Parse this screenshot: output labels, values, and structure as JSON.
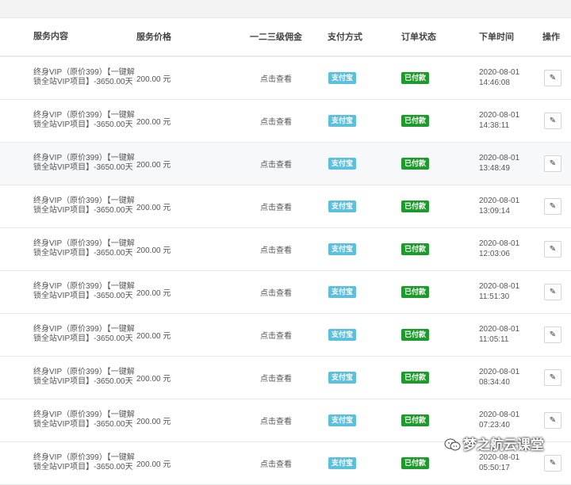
{
  "table": {
    "headers": {
      "service": "服务内容",
      "price": "服务价格",
      "commission": "一二三级佣金",
      "pay_method": "支付方式",
      "status": "订单状态",
      "time": "下单时间",
      "action": "操作"
    },
    "rows": [
      {
        "service": "终身VIP（原价399）【一键解锁全站VIP项目】-3650.00天",
        "price": "200.00 元",
        "commission": "点击查看",
        "pay": "支付宝",
        "status": "已付款",
        "date": "2020-08-01",
        "time": "14:46:08"
      },
      {
        "service": "终身VIP（原价399）【一键解锁全站VIP项目】-3650.00天",
        "price": "200.00 元",
        "commission": "点击查看",
        "pay": "支付宝",
        "status": "已付款",
        "date": "2020-08-01",
        "time": "14:38:11"
      },
      {
        "service": "终身VIP（原价399）【一键解锁全站VIP项目】-3650.00天",
        "price": "200.00 元",
        "commission": "点击查看",
        "pay": "支付宝",
        "status": "已付款",
        "date": "2020-08-01",
        "time": "13:48:49"
      },
      {
        "service": "终身VIP（原价399）【一键解锁全站VIP项目】-3650.00天",
        "price": "200.00 元",
        "commission": "点击查看",
        "pay": "支付宝",
        "status": "已付款",
        "date": "2020-08-01",
        "time": "13:09:14"
      },
      {
        "service": "终身VIP（原价399）【一键解锁全站VIP项目】-3650.00天",
        "price": "200.00 元",
        "commission": "点击查看",
        "pay": "支付宝",
        "status": "已付款",
        "date": "2020-08-01",
        "time": "12:03:06"
      },
      {
        "service": "终身VIP（原价399）【一键解锁全站VIP项目】-3650.00天",
        "price": "200.00 元",
        "commission": "点击查看",
        "pay": "支付宝",
        "status": "已付款",
        "date": "2020-08-01",
        "time": "11:51:30"
      },
      {
        "service": "终身VIP（原价399）【一键解锁全站VIP项目】-3650.00天",
        "price": "200.00 元",
        "commission": "点击查看",
        "pay": "支付宝",
        "status": "已付款",
        "date": "2020-08-01",
        "time": "11:05:11"
      },
      {
        "service": "终身VIP（原价399）【一键解锁全站VIP项目】-3650.00天",
        "price": "200.00 元",
        "commission": "点击查看",
        "pay": "支付宝",
        "status": "已付款",
        "date": "2020-08-01",
        "time": "08:34:40"
      },
      {
        "service": "终身VIP（原价399）【一键解锁全站VIP项目】-3650.00天",
        "price": "200.00 元",
        "commission": "点击查看",
        "pay": "支付宝",
        "status": "已付款",
        "date": "2020-08-01",
        "time": "07:23:40"
      },
      {
        "service": "终身VIP（原价399）【一键解锁全站VIP项目】-3650.00天",
        "price": "200.00 元",
        "commission": "点击查看",
        "pay": "支付宝",
        "status": "已付款",
        "date": "2020-08-01",
        "time": "05:50:17"
      }
    ]
  },
  "icons": {
    "edit": "pencil-icon",
    "watermark": "wechat-icon"
  },
  "colors": {
    "pay_badge": "#5bc0de",
    "status_badge": "#1c9a2a"
  },
  "watermark": {
    "text": "梦之航云课堂"
  }
}
